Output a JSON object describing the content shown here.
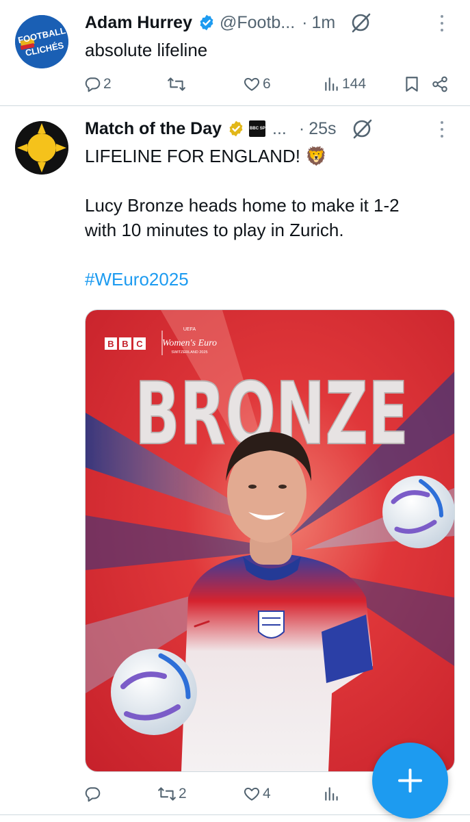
{
  "tweets": [
    {
      "author": "Adam Hurrey",
      "handle": "@Footb...",
      "dot": "·",
      "time": "1m",
      "text": "absolute lifeline",
      "avatar_text_top": "FOOTBALL",
      "avatar_text_bottom": "CLICHÉS",
      "replies": "2",
      "retweets": "",
      "likes": "6",
      "views": "144"
    },
    {
      "author": "Match of the Day",
      "badge_text": "BBC SPORT",
      "handle": "...",
      "dot": "·",
      "time": "25s",
      "text_line1": "LIFELINE FOR ENGLAND! 🦁",
      "text_line2": "Lucy Bronze heads home to make it 1-2",
      "text_line3": "with 10 minutes to play in Zurich.",
      "hashtag": "#WEuro2025",
      "replies": "",
      "retweets": "2",
      "likes": "4",
      "views": ""
    }
  ],
  "media": {
    "headline": "BRONZE",
    "broadcaster": "BBC",
    "tournament_small": "UEFA",
    "tournament_name": "Women's Euro",
    "tournament_sub": "SWITZERLAND 2025"
  },
  "fab_symbol": "+",
  "colors": {
    "accent": "#1d9bf0",
    "verified_blue": "#1d9bf0",
    "verified_gold": "#e2b719",
    "poster_red": "#d92a2e"
  }
}
